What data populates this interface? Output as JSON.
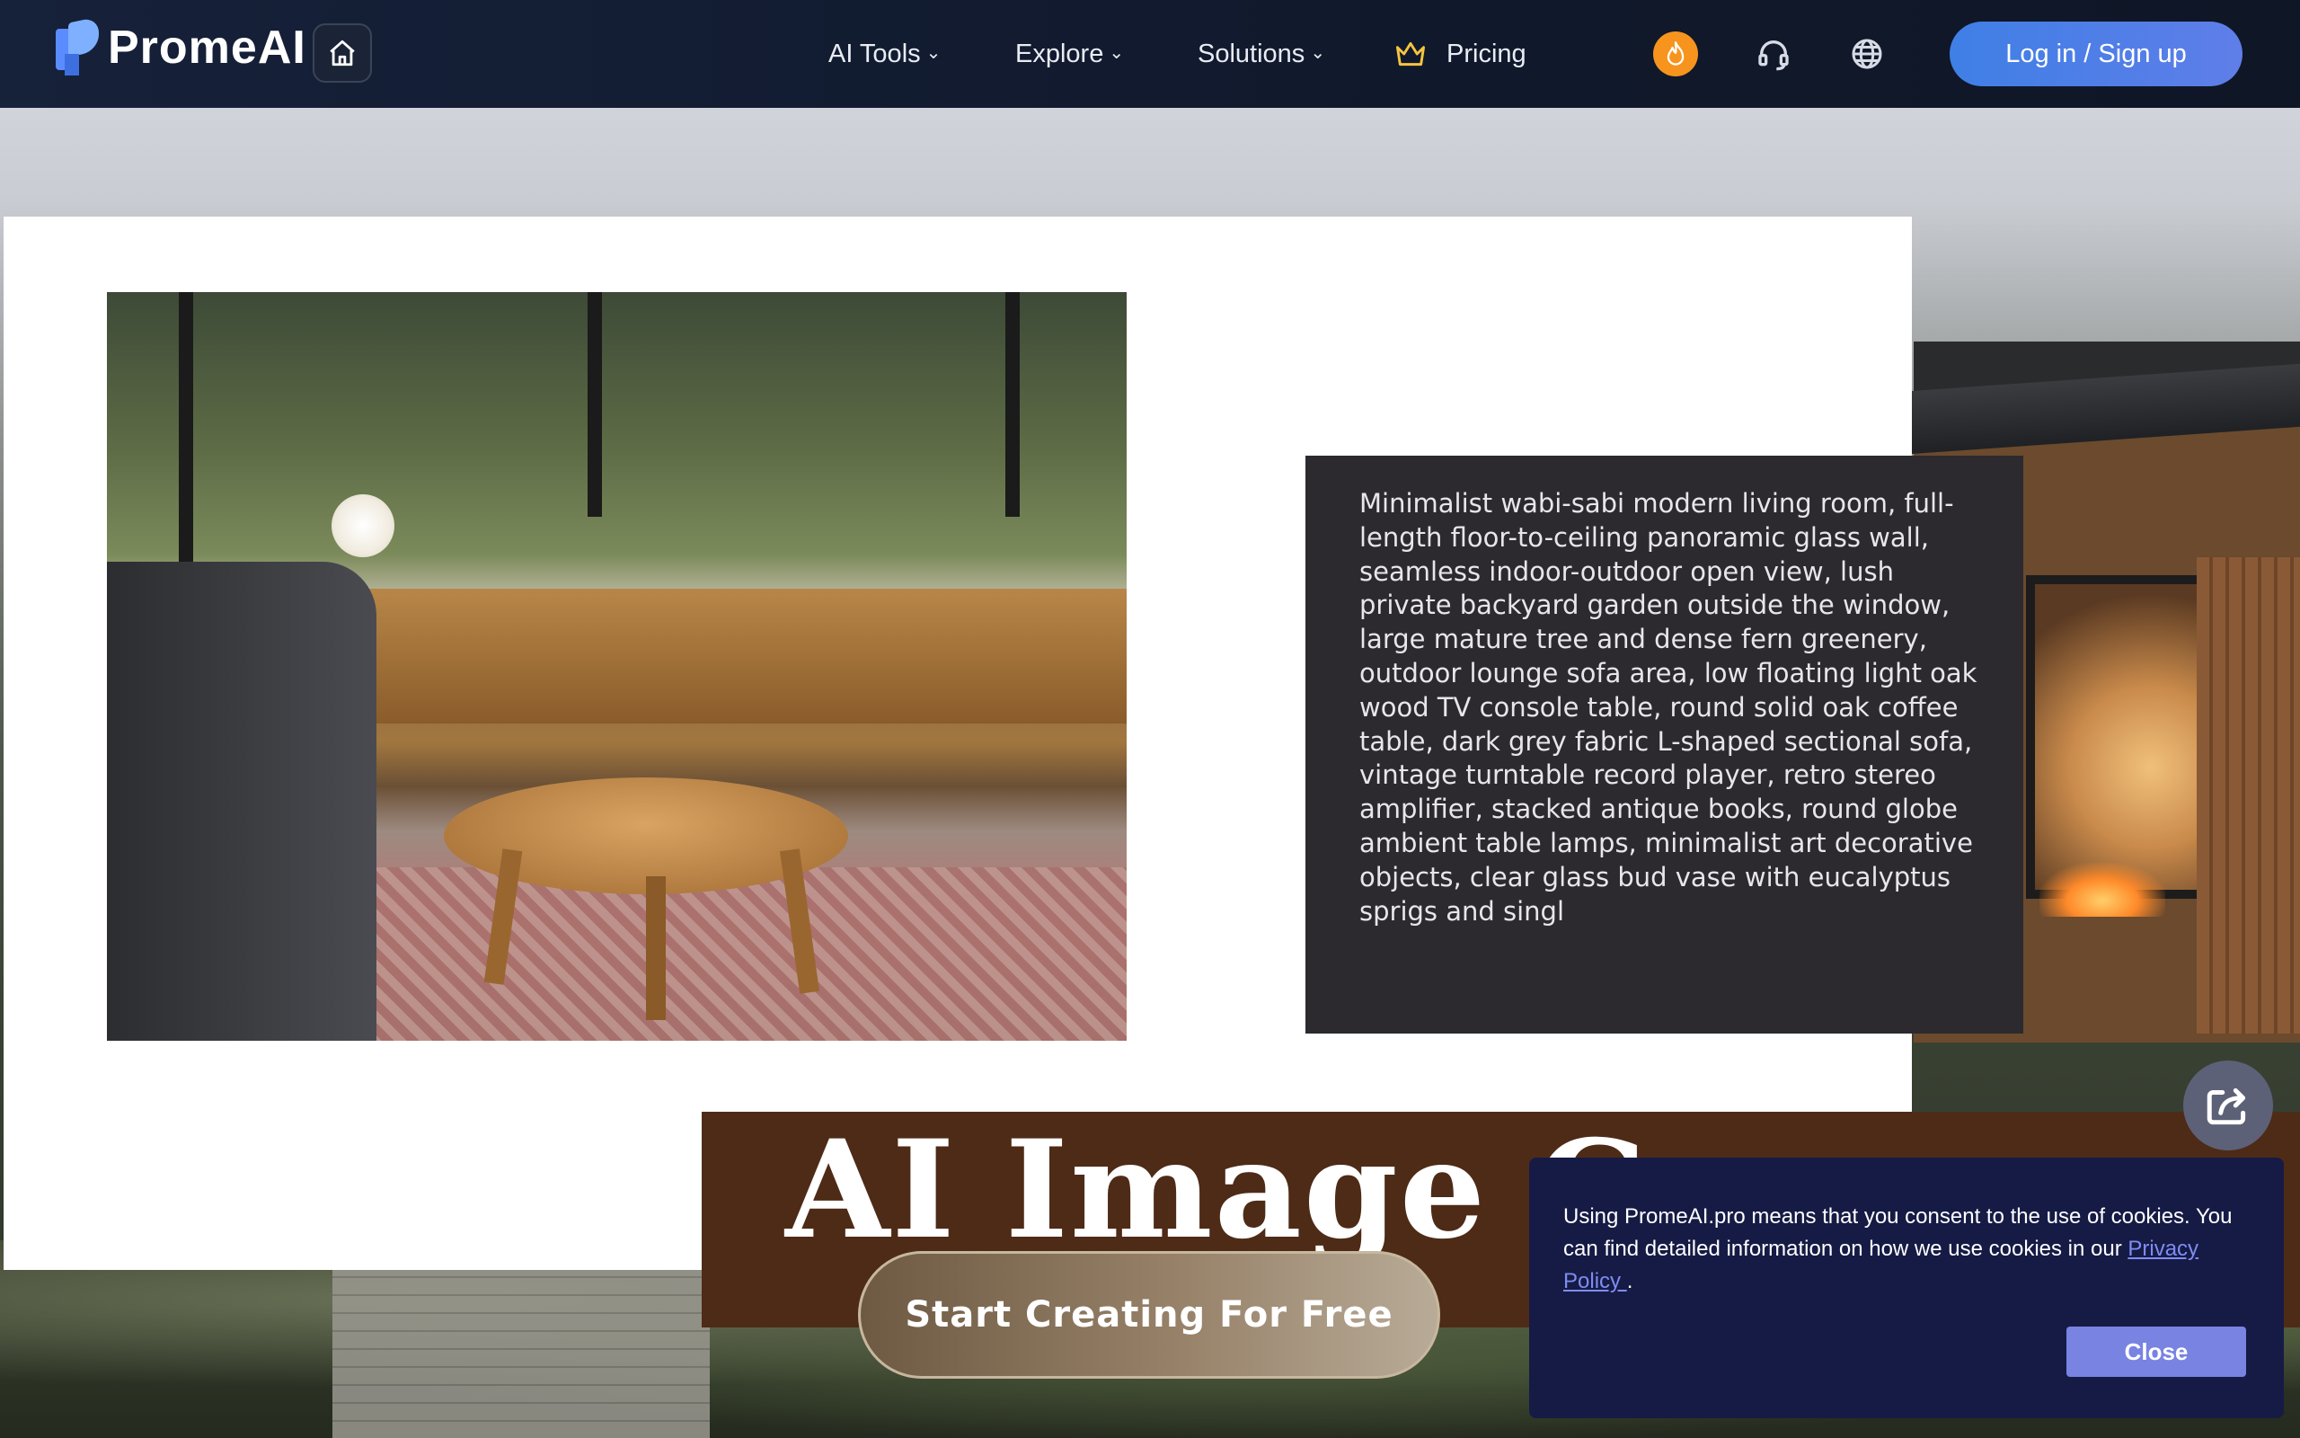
{
  "brand": {
    "name": "PromeAI"
  },
  "nav": {
    "items": [
      {
        "label": "AI Tools",
        "has_dropdown": true
      },
      {
        "label": "Explore",
        "has_dropdown": true
      },
      {
        "label": "Solutions",
        "has_dropdown": true
      },
      {
        "label": "Pricing",
        "icon": "crown-icon"
      }
    ],
    "icons": [
      "home-icon",
      "fire-icon",
      "headset-icon",
      "globe-icon"
    ],
    "login_label": "Log in / Sign up"
  },
  "hero": {
    "prompt_text": "Minimalist wabi-sabi modern living room, full-length floor-to-ceiling panoramic glass wall, seamless indoor-outdoor open view, lush private backyard garden outside the window, large mature tree and dense fern greenery, outdoor lounge sofa area, low floating light oak wood TV console table, round solid oak coffee table, dark grey fabric L-shaped sectional sofa, vintage turntable record player, retro stereo amplifier, stacked antique books, round globe ambient table lamps, minimalist art decorative objects, clear glass bud vase with eucalyptus sprigs and singl",
    "title": "AI Image G",
    "cta_label": "Start Creating For Free"
  },
  "cookie": {
    "text": "Using PromeAI.pro means that you consent to the use of cookies. You can find detailed information on how we use cookies in our",
    "link_label": "Privacy Policy ",
    "suffix": ".",
    "close_label": "Close"
  },
  "colors": {
    "nav_bg": "#111a2e",
    "accent_blue": "#3f7fe6",
    "fire_orange": "#f7941d",
    "hero_band": "#4e2b17",
    "cookie_bg": "#161b45",
    "cookie_button": "#7883e2"
  }
}
